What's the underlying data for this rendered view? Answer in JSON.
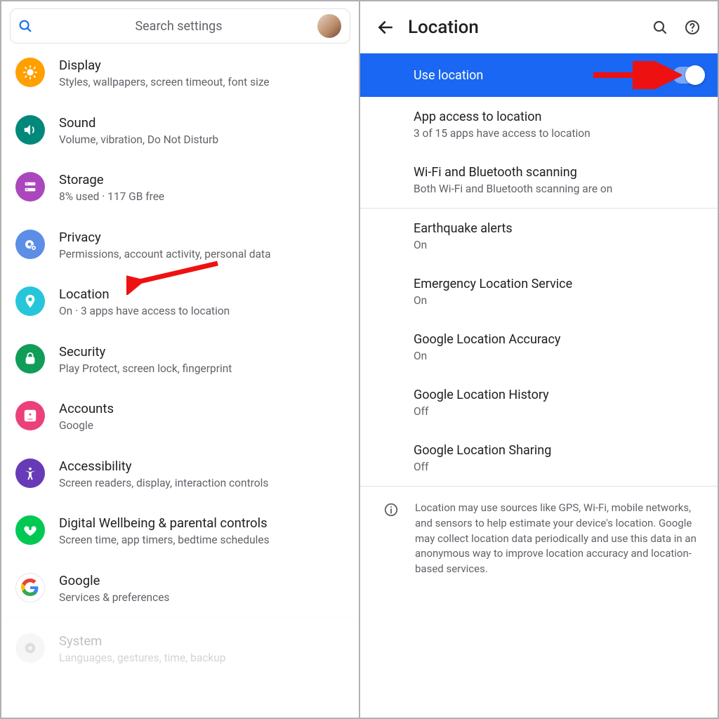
{
  "left": {
    "search_placeholder": "Search settings",
    "items": [
      {
        "key": "display",
        "title": "Display",
        "subtitle": "Styles, wallpapers, screen timeout, font size",
        "color": "bg-orange"
      },
      {
        "key": "sound",
        "title": "Sound",
        "subtitle": "Volume, vibration, Do Not Disturb",
        "color": "bg-teal"
      },
      {
        "key": "storage",
        "title": "Storage",
        "subtitle": "8% used · 117 GB free",
        "color": "bg-purple"
      },
      {
        "key": "privacy",
        "title": "Privacy",
        "subtitle": "Permissions, account activity, personal data",
        "color": "bg-blue"
      },
      {
        "key": "location",
        "title": "Location",
        "subtitle": "On · 3 apps have access to location",
        "color": "bg-cyan",
        "annotated": true
      },
      {
        "key": "security",
        "title": "Security",
        "subtitle": "Play Protect, screen lock, fingerprint",
        "color": "bg-green"
      },
      {
        "key": "accounts",
        "title": "Accounts",
        "subtitle": "Google",
        "color": "bg-pink"
      },
      {
        "key": "accessibility",
        "title": "Accessibility",
        "subtitle": "Screen readers, display, interaction controls",
        "color": "bg-violet"
      },
      {
        "key": "wellbeing",
        "title": "Digital Wellbeing & parental controls",
        "subtitle": "Screen time, app timers, bedtime schedules",
        "color": "bg-green2"
      },
      {
        "key": "google",
        "title": "Google",
        "subtitle": "Services & preferences",
        "color": "g-logo"
      },
      {
        "key": "system",
        "title": "System",
        "subtitle": "Languages, gestures, time, backup",
        "color": "bg-grey",
        "faded": true
      }
    ]
  },
  "right": {
    "header_title": "Location",
    "feature": {
      "label": "Use location",
      "on": true
    },
    "group1": [
      {
        "title": "App access to location",
        "subtitle": "3 of 15 apps have access to location"
      },
      {
        "title": "Wi-Fi and Bluetooth scanning",
        "subtitle": "Both Wi-Fi and Bluetooth scanning are on"
      }
    ],
    "group2": [
      {
        "title": "Earthquake alerts",
        "subtitle": "On"
      },
      {
        "title": "Emergency Location Service",
        "subtitle": "On"
      },
      {
        "title": "Google Location Accuracy",
        "subtitle": "On"
      },
      {
        "title": "Google Location History",
        "subtitle": "Off"
      },
      {
        "title": "Google Location Sharing",
        "subtitle": "Off"
      }
    ],
    "info_text": "Location may use sources like GPS, Wi-Fi, mobile networks, and sensors to help estimate your device's location. Google may collect location data periodically and use this data in an anonymous way to improve location accuracy and location-based services."
  }
}
